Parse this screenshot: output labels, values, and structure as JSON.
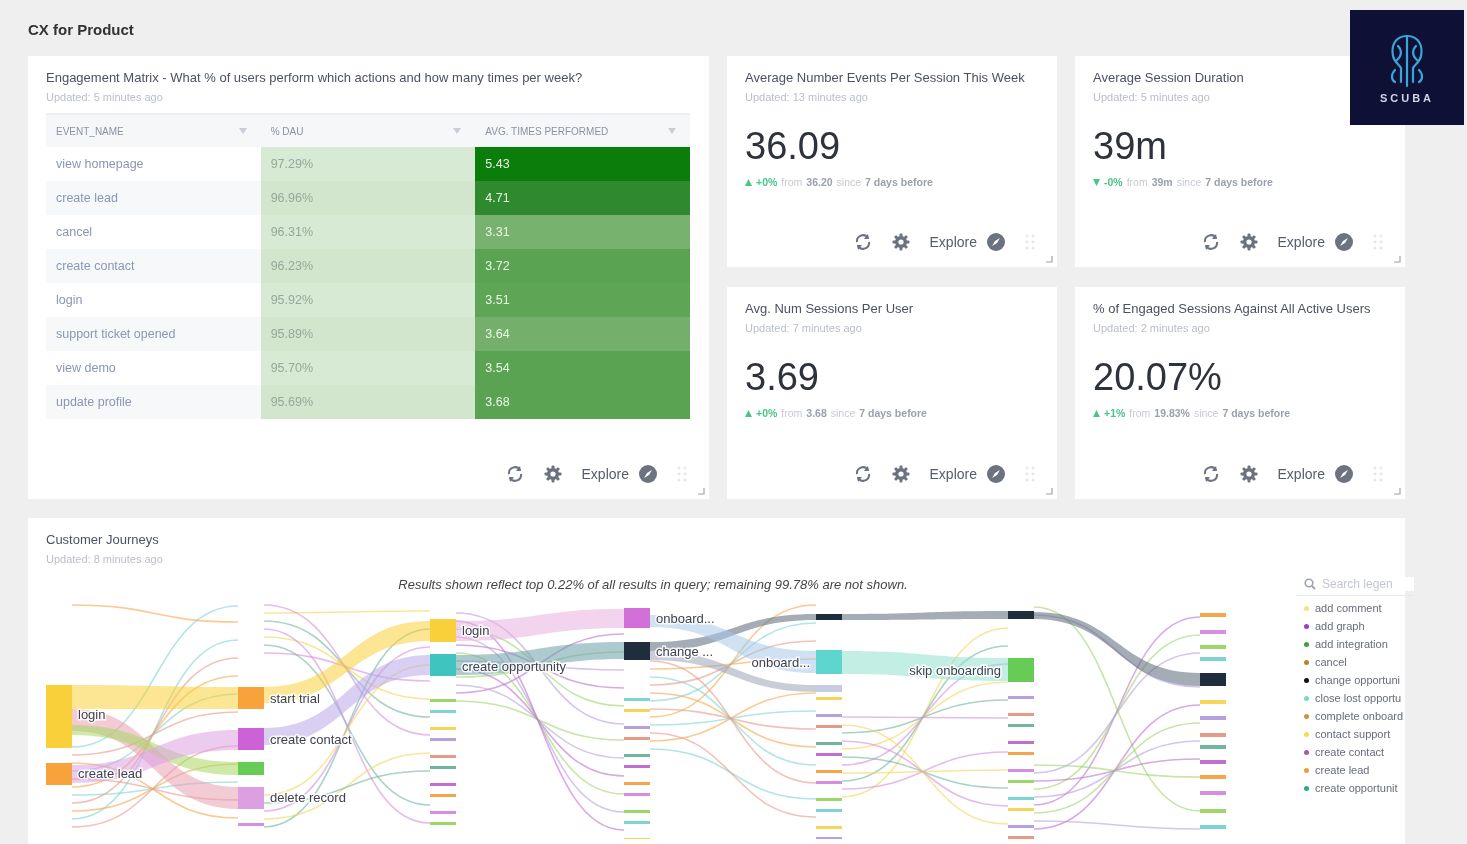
{
  "page_title": "CX for Product",
  "logo": {
    "text": "SCUBA"
  },
  "matrix": {
    "title": "Engagement Matrix - What % of users perform which actions and how many times per week?",
    "updated": "Updated: 5 minutes ago",
    "columns": [
      "EVENT_NAME",
      "% DAU",
      "AVG. TIMES PERFORMED"
    ],
    "rows": [
      {
        "event": "view homepage",
        "dau": "97.29%",
        "avg": "5.43",
        "color": "#0b7d0b"
      },
      {
        "event": "create lead",
        "dau": "96.96%",
        "avg": "4.71",
        "color": "#2f8a2f"
      },
      {
        "event": "cancel",
        "dau": "96.31%",
        "avg": "3.31",
        "color": "#78b26f"
      },
      {
        "event": "create contact",
        "dau": "96.23%",
        "avg": "3.72",
        "color": "#5aa352"
      },
      {
        "event": "login",
        "dau": "95.92%",
        "avg": "3.51",
        "color": "#5ea656"
      },
      {
        "event": "support ticket opened",
        "dau": "95.89%",
        "avg": "3.64",
        "color": "#74b06b"
      },
      {
        "event": "view demo",
        "dau": "95.70%",
        "avg": "3.54",
        "color": "#5aa352"
      },
      {
        "event": "update profile",
        "dau": "95.69%",
        "avg": "3.68",
        "color": "#5aa352"
      }
    ],
    "action": "Explore"
  },
  "metrics": [
    {
      "title": "Average Number Events Per Session This Week",
      "updated": "Updated: 13 minutes ago",
      "value": "36.09",
      "delta": {
        "rising": true,
        "change": "+0%",
        "from_word": "from",
        "previous": "36.20",
        "since_word": "since",
        "period": "7 days before"
      },
      "action": "Explore"
    },
    {
      "title": "Average Session Duration",
      "updated": "Updated: 5 minutes ago",
      "value": "39m",
      "delta": {
        "rising": false,
        "change": "-0%",
        "from_word": "from",
        "previous": "39m",
        "since_word": "since",
        "period": "7 days before"
      },
      "action": "Explore"
    },
    {
      "title": "Avg. Num Sessions Per User",
      "updated": "Updated: 7 minutes ago",
      "value": "3.69",
      "delta": {
        "rising": true,
        "change": "+0%",
        "from_word": "from",
        "previous": "3.68",
        "since_word": "since",
        "period": "7 days before"
      },
      "action": "Explore"
    },
    {
      "title": "% of Engaged Sessions Against All Active Users",
      "updated": "Updated: 2 minutes ago",
      "value": "20.07%",
      "delta": {
        "rising": true,
        "change": "+1%",
        "from_word": "from",
        "previous": "19.83%",
        "since_word": "since",
        "period": "7 days before"
      },
      "action": "Explore"
    }
  ],
  "journeys": {
    "title": "Customer Journeys",
    "updated": "Updated: 8 minutes ago",
    "caption": "Results shown reflect top 0.22% of all results in query; remaining 99.78% are not shown.",
    "columns": [
      [
        {
          "label": "login",
          "color": "#f9cf3a"
        },
        {
          "label": "create lead",
          "color": "#f7a23a"
        }
      ],
      [
        {
          "label": "start trial",
          "color": "#f7a23a"
        },
        {
          "label": "create contact",
          "color": "#cc62d6"
        },
        {
          "label": "delete record",
          "color": "#dca0e2"
        }
      ],
      [
        {
          "label": "login",
          "color": "#f9cf3a"
        },
        {
          "label": "create opportunity",
          "color": "#3fc4c0"
        }
      ],
      [
        {
          "label": "onboard...",
          "color": "#d26fd8"
        },
        {
          "label": "change ...",
          "color": "#1f2d3d"
        }
      ],
      [
        {
          "label": "onboard...",
          "color": "#5fd5cf"
        }
      ],
      [
        {
          "label": "skip onboarding",
          "color": "#66cc55"
        }
      ]
    ],
    "search": {
      "placeholder": "Search legen"
    },
    "legend": [
      {
        "label": "add comment",
        "color": "#fbe07a"
      },
      {
        "label": "add graph",
        "color": "#9b3fc4"
      },
      {
        "label": "add integration",
        "color": "#3f9e3f"
      },
      {
        "label": "cancel",
        "color": "#b8862a"
      },
      {
        "label": "change opportuni",
        "color": "#111111"
      },
      {
        "label": "close lost opportu",
        "color": "#7ad8c8"
      },
      {
        "label": "complete onboard",
        "color": "#c8963a"
      },
      {
        "label": "contact support",
        "color": "#f6dc4a"
      },
      {
        "label": "create contact",
        "color": "#a55aa5"
      },
      {
        "label": "create lead",
        "color": "#f29a3a"
      },
      {
        "label": "create opportunit",
        "color": "#2aa88a"
      }
    ]
  }
}
